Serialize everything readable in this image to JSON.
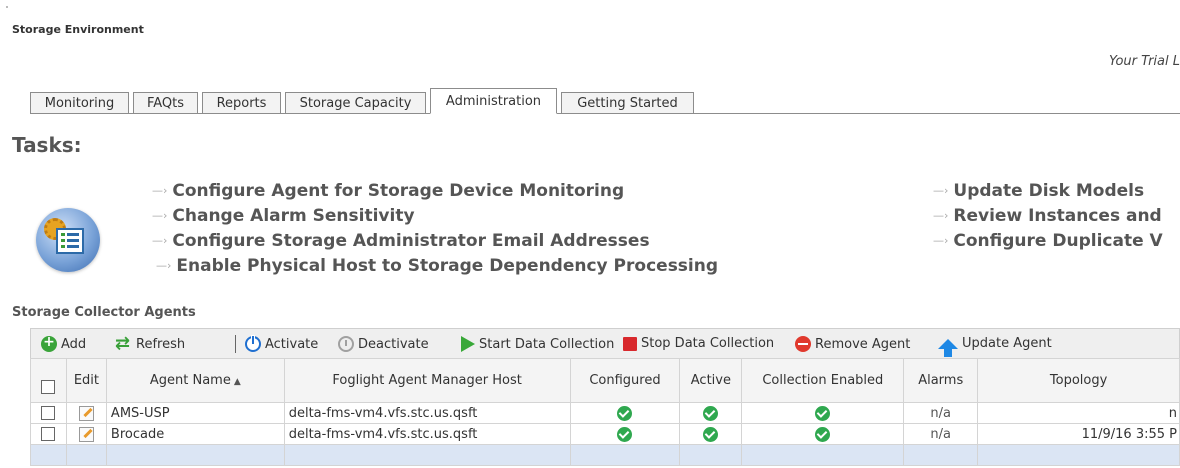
{
  "header": {
    "title": "Storage Environment",
    "trial_text": "Your Trial L"
  },
  "tabs": [
    {
      "label": "Monitoring",
      "active": false
    },
    {
      "label": "FAQts",
      "active": false
    },
    {
      "label": "Reports",
      "active": false
    },
    {
      "label": "Storage Capacity",
      "active": false
    },
    {
      "label": "Administration",
      "active": true
    },
    {
      "label": "Getting Started",
      "active": false
    }
  ],
  "tasks": {
    "heading": "Tasks:",
    "icon": "admin-tasks-icon",
    "left_links": [
      "Configure Agent for Storage Device Monitoring",
      "Change Alarm Sensitivity",
      "Configure Storage Administrator Email Addresses",
      "Enable Physical Host to Storage Dependency Processing"
    ],
    "right_links": [
      "Update Disk Models",
      "Review Instances and",
      "Configure Duplicate V"
    ]
  },
  "collectors": {
    "heading": "Storage Collector Agents",
    "toolbar": {
      "add": "Add",
      "refresh": "Refresh",
      "activate": "Activate",
      "deactivate": "Deactivate",
      "start": "Start Data Collection",
      "stop": "Stop Data Collection",
      "remove": "Remove Agent",
      "update": "Update Agent"
    },
    "columns": {
      "edit": "Edit",
      "agent_name": "Agent Name",
      "host": "Foglight Agent Manager Host",
      "configured": "Configured",
      "active": "Active",
      "collection_enabled": "Collection Enabled",
      "alarms": "Alarms",
      "topology": "Topology"
    },
    "rows": [
      {
        "name": "AMS-USP",
        "host": "delta-fms-vm4.vfs.stc.us.qsft",
        "alarms": "n/a",
        "topology": "n"
      },
      {
        "name": "Brocade",
        "host": "delta-fms-vm4.vfs.stc.us.qsft",
        "alarms": "n/a",
        "topology": "11/9/16 3:55 P"
      }
    ]
  },
  "colors": {
    "tab_border": "#8c8c8c",
    "toolbar_bg": "#efefef",
    "ok_green": "#2fa84f",
    "selected_row": "#dbe5f4"
  }
}
